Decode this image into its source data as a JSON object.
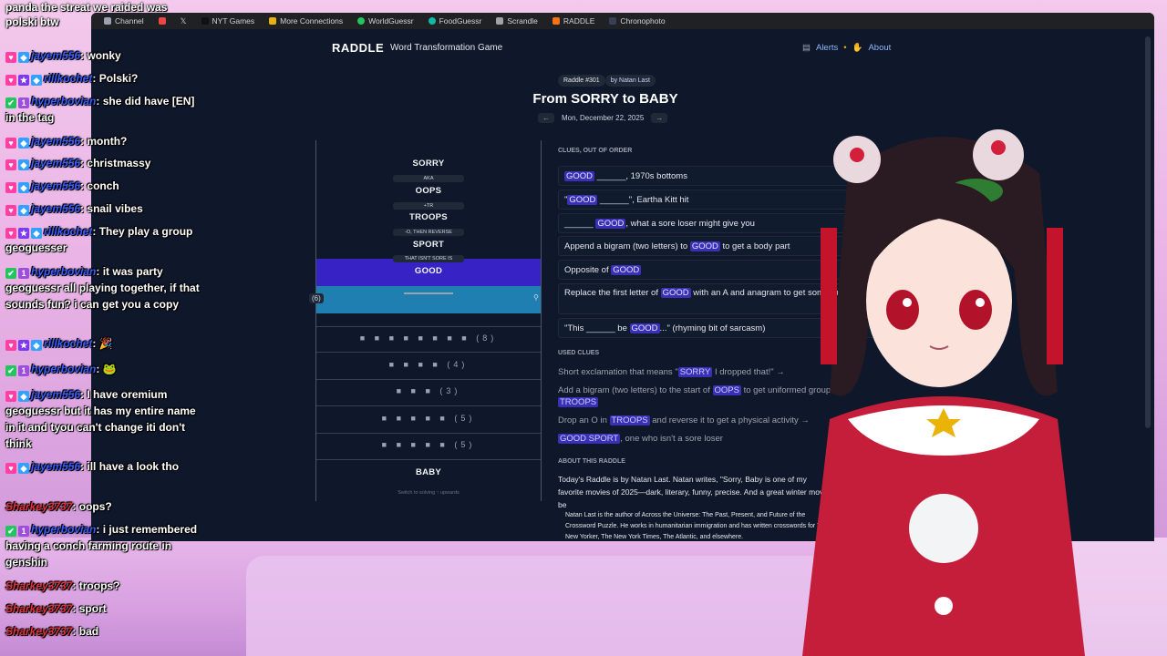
{
  "bookmarks": [
    "Channel",
    "NYT Games",
    "More Connections",
    "WorldGuessr",
    "FoodGuessr",
    "Scrandle",
    "RADDLE",
    "Chronophoto"
  ],
  "header": {
    "logo": "RADDLE",
    "tagline": "Word Transformation Game",
    "alerts": "Alerts",
    "about": "About"
  },
  "puzzle": {
    "number": "Raddle #301",
    "author": "by Natan Last",
    "title": "From SORRY to BABY",
    "date": "Mon, December 22, 2025",
    "prev": "←",
    "next": "→"
  },
  "ladder": {
    "words": [
      "SORRY",
      "OOPS",
      "TROOPS",
      "SPORT",
      "GOOD",
      "BABY"
    ],
    "hints": [
      "AKA",
      "+TR",
      "-O, THEN REVERSE",
      "THAT ISN'T SORE IS"
    ],
    "active_count": "(6)",
    "pin": "⚲",
    "blank_rows": [
      {
        "boxes": "■ ■ ■ ■ ■ ■ ■ ■",
        "count": "(8)"
      },
      {
        "boxes": "■ ■ ■ ■",
        "count": "(4)"
      },
      {
        "boxes": "■ ■ ■",
        "count": "(3)"
      },
      {
        "boxes": "■ ■ ■ ■ ■",
        "count": "(5)"
      },
      {
        "boxes": "■ ■ ■ ■ ■",
        "count": "(5)"
      }
    ],
    "switch_text": "Switch to solving ↑ upwards"
  },
  "clues": {
    "label": "CLUES, OUT OF ORDER",
    "items": [
      {
        "pre": "",
        "hl": "GOOD",
        "post": " ______, 1970s bottoms"
      },
      {
        "pre": "\"",
        "hl": "GOOD",
        "post": " ______\", Eartha Kitt hit"
      },
      {
        "pre": "______ ",
        "hl": "GOOD",
        "post": ", what a sore loser might give you"
      },
      {
        "pre": "Append a bigram (two letters) to ",
        "hl": "GOOD",
        "post": " to get a body part"
      },
      {
        "pre": "Opposite of ",
        "hl": "GOOD",
        "post": ""
      },
      {
        "pre": "Replace the first letter of ",
        "hl": "GOOD",
        "post": " with an A and anagram to get someone dressed in red"
      },
      {
        "pre": "\"This ______ be ",
        "hl": "GOOD",
        "post": "...\" (rhyming bit of sarcasm)"
      }
    ]
  },
  "used": {
    "label": "USED CLUES",
    "items": [
      {
        "pre": "Short exclamation that means \"",
        "hl": "SORRY",
        "post": " I dropped that!\" →"
      },
      {
        "pre": "Add a bigram (two letters) to the start of ",
        "hl": "OOPS",
        "post": " to get uniformed groups →"
      },
      {
        "pre": "",
        "hl": "TROOPS",
        "post": ""
      },
      {
        "pre": "Drop an O in ",
        "hl": "TROOPS",
        "post": " and reverse it to get a physical activity →"
      },
      {
        "pre": "",
        "hl": "GOOD SPORT",
        "post": ", one who isn't a sore loser"
      }
    ]
  },
  "about": {
    "label": "ABOUT THIS RADDLE",
    "text": "Today's Raddle is by Natan Last. Natan writes, \"Sorry, Baby is one of my favorite movies of 2025—dark, literary, funny, precise. And a great winter movie be",
    "bio": "Natan Last is the author of Across the Universe: The Past, Present, and Future of the Crossword Puzzle. He works in humanitarian immigration and has written crosswords for The New Yorker, The New York Times, The Atlantic, and elsewhere."
  },
  "chat": {
    "top": [
      "panda the streat we raided was",
      "polski btw"
    ],
    "messages": [
      {
        "user": "jayem556",
        "color": "blue",
        "text": "wonky"
      },
      {
        "user": "rillkochet",
        "color": "blue",
        "text": "Polski?"
      },
      {
        "user": "hyperbovian",
        "color": "blue",
        "text": "she did have [EN] in the tag"
      },
      {
        "user": "jayem556",
        "color": "blue",
        "text": "month?"
      },
      {
        "user": "jayem556",
        "color": "blue",
        "text": "christmassy"
      },
      {
        "user": "jayem556",
        "color": "blue",
        "text": "conch"
      },
      {
        "user": "jayem556",
        "color": "blue",
        "text": "snail vibes"
      },
      {
        "user": "rillkochet",
        "color": "blue",
        "text": "They play a group geoguesser"
      },
      {
        "user": "hyperbovian",
        "color": "blue",
        "text": "it was party geoguessr all playing together, if that sounds fun? i can get you a copy"
      },
      {
        "user": "rillkochet",
        "color": "blue",
        "text": "🎉"
      },
      {
        "user": "hyperbovian",
        "color": "blue",
        "text": "🐸"
      },
      {
        "user": "jayem556",
        "color": "blue",
        "text": "I have oremium geoguessr but it has my entire name in it and tyou can't change iti don't think"
      },
      {
        "user": "jayem556",
        "color": "blue",
        "text": "ill have a look tho"
      },
      {
        "user": "Sharkey3737",
        "color": "red",
        "text": "oops?"
      },
      {
        "user": "hyperbovian",
        "color": "blue",
        "text": "i just remembered having a conch farming route in genshin"
      },
      {
        "user": "Sharkey3737",
        "color": "red",
        "text": "troops?"
      },
      {
        "user": "Sharkey3737",
        "color": "red",
        "text": "sport"
      },
      {
        "user": "Sharkey3737",
        "color": "red",
        "text": "bad"
      }
    ]
  },
  "colors": {
    "accent": "#3723c5",
    "input": "#1f7fb0",
    "bg": "#0f172a",
    "chat_blue": "#3a5dff",
    "chat_red": "#e0343c"
  }
}
